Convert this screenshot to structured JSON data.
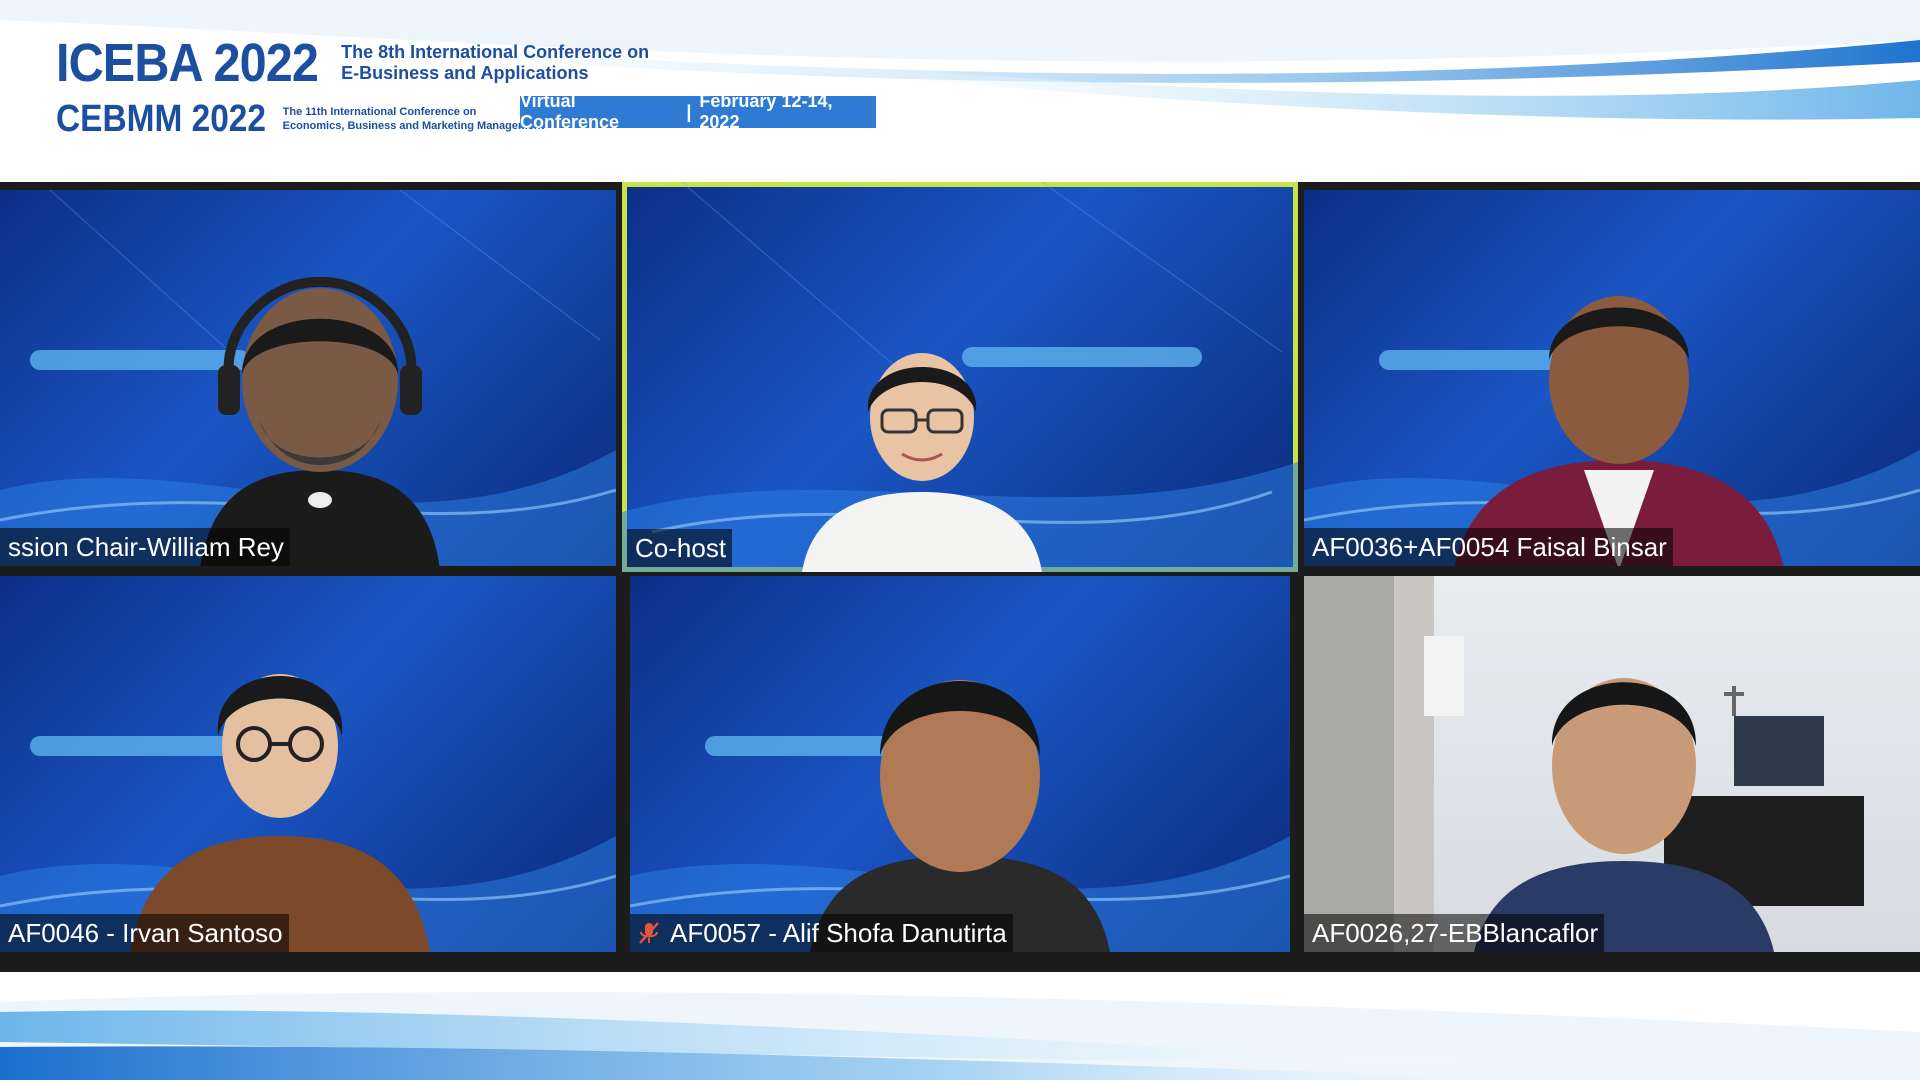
{
  "header": {
    "event1_title": "ICEBA 2022",
    "event1_subtitle_line1": "The 8th International Conference on",
    "event1_subtitle_line2": "E-Business and Applications",
    "event2_title": "CEBMM 2022",
    "event2_subtitle_line1": "The 11th International Conference on",
    "event2_subtitle_line2": "Economics, Business and Marketing Management",
    "virtual_label": "Virtual Conference",
    "separator": "|",
    "dates": "February 12-14, 2022"
  },
  "participants": [
    {
      "name": "ssion Chair-William Rey",
      "active": false,
      "muted": false
    },
    {
      "name": "Co-host",
      "active": true,
      "muted": false
    },
    {
      "name": "AF0036+AF0054 Faisal Binsar",
      "active": false,
      "muted": false
    },
    {
      "name": "AF0046 - Irvan Santoso",
      "active": false,
      "muted": false
    },
    {
      "name": "AF0057 - Alif Shofa Danutirta",
      "active": false,
      "muted": true
    },
    {
      "name": "AF0026,27-EBBlancaflor",
      "active": false,
      "muted": false
    }
  ],
  "colors": {
    "brand_blue": "#1c4fa0",
    "virtual_bar": "#2f7bd3",
    "active_speaker": "#c7e24a",
    "grid_bg": "#1c1c1c"
  }
}
